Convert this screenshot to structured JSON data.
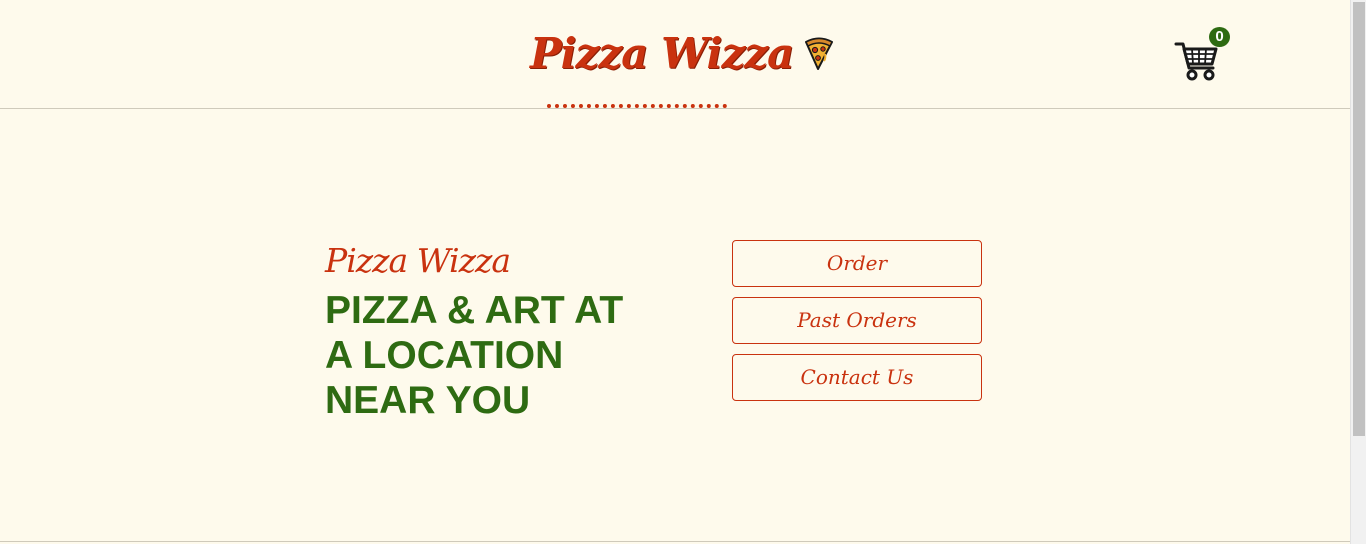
{
  "header": {
    "brand_title": "Pizza Wizza",
    "brand_icon": "pizza-slice-icon",
    "cart_icon": "shopping-cart-icon",
    "cart_count": "0"
  },
  "hero": {
    "brand_title": "Pizza Wizza",
    "tagline": "PIZZA & ART AT A LOCATION NEAR YOU"
  },
  "nav": {
    "order_label": "Order",
    "past_orders_label": "Past Orders",
    "contact_us_label": "Contact Us"
  },
  "colors": {
    "background": "#fefaec",
    "brand_red": "#c9320f",
    "brand_green": "#2e6b12"
  }
}
